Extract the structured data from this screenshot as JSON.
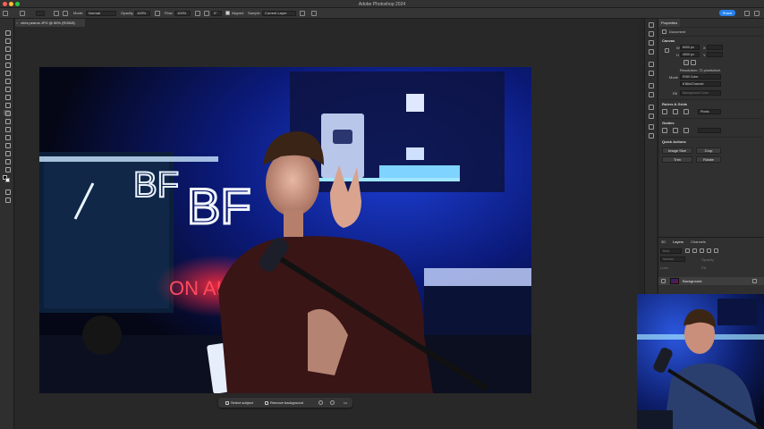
{
  "app": {
    "title": "Adobe Photoshop 2024"
  },
  "options_bar": {
    "mode_label": "Mode:",
    "mode_value": "Normal",
    "opacity_label": "Opacity:",
    "opacity_value": "100%",
    "flow_label": "Flow:",
    "flow_value": "100%",
    "angle_value": "0°",
    "aligned_label": "Aligned",
    "sample_label": "Sample:",
    "sample_value": "Current Layer",
    "share_label": "Share"
  },
  "document": {
    "tab_label": "chris pearce.JPG @ 50% (RGB/8)",
    "close_glyph": "×"
  },
  "taskbar": {
    "select_subject": "Select subject",
    "remove_background": "Remove background",
    "more": "•••"
  },
  "properties": {
    "tab": "Properties",
    "doc_label": "Document",
    "canvas_section": "Canvas",
    "w_label": "W",
    "w_value": "6000 px",
    "h_label": "H",
    "h_value": "4000 px",
    "x_label": "X",
    "y_label": "Y",
    "resolution": "Resolution: 72 pixels/inch",
    "mode_label": "Mode",
    "mode_value": "RGB Color",
    "depth_value": "8 Bits/Channel",
    "fill_label": "Fill",
    "fill_value": "Background Color",
    "rulers_section": "Rulers & Grids",
    "rulers_unit": "Pixels",
    "guides_section": "Guides",
    "quick_actions_section": "Quick Actions",
    "qa_image_size": "Image Size",
    "qa_crop": "Crop",
    "qa_trim": "Trim",
    "qa_rotate": "Rotate"
  },
  "layers": {
    "tabs": [
      "3D",
      "Layers",
      "Channels"
    ],
    "kind_label": "Kind",
    "blend_mode": "Normal",
    "opacity_label": "Opacity:",
    "lock_label": "Lock:",
    "fill_label": "Fill:",
    "layer_name": "Background"
  },
  "colors": {
    "accent": "#2680eb",
    "ui_dark": "#262626",
    "panel": "#303030"
  }
}
